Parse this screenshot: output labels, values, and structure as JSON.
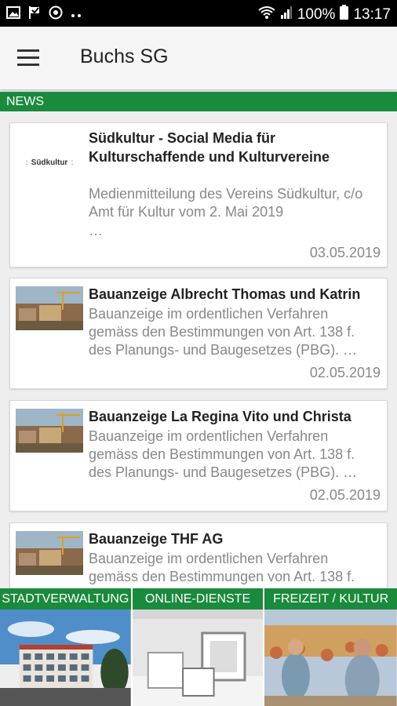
{
  "status_bar": {
    "battery": "100%",
    "time": "13:17",
    "icons": [
      "image-icon",
      "check-flag-icon",
      "target-icon",
      "more-dots-icon",
      "wifi-icon",
      "signal-icon",
      "battery-icon"
    ]
  },
  "app_bar": {
    "title": "Buchs SG"
  },
  "section": {
    "title": "NEWS"
  },
  "news": [
    {
      "thumb_text": "Südkultur",
      "title": "Südkultur - Social Media für Kulturschaffende und Kulturvereine",
      "description": "Medienmitteilung des Vereins Südkultur, c/o Amt für Kultur vom 2. Mai 2019",
      "ellipsis": "…",
      "date": "03.05.2019"
    },
    {
      "title": "Bauanzeige Albrecht Thomas und Katrin",
      "description": "Bauanzeige im ordentlichen Verfahren gemäss den Bestimmungen von Art. 138 f. des Planungs- und Baugesetzes (PBG). …",
      "date": "02.05.2019"
    },
    {
      "title": "Bauanzeige La Regina Vito und Christa",
      "description": "Bauanzeige im ordentlichen Verfahren gemäss den Bestimmungen von Art. 138 f. des Planungs- und Baugesetzes (PBG). …",
      "date": "02.05.2019"
    },
    {
      "title": "Bauanzeige THF AG",
      "description": "Bauanzeige im ordentlichen Verfahren gemäss den Bestimmungen von Art. 138 f."
    }
  ],
  "tiles": [
    {
      "label": "STADTVERWALTUNG"
    },
    {
      "label": "ONLINE-DIENSTE"
    },
    {
      "label": "FREIZEIT / KULTUR"
    }
  ],
  "colors": {
    "accent_green": "#1a8a3c",
    "status_bar": "#000000",
    "background": "#eeeeee"
  }
}
